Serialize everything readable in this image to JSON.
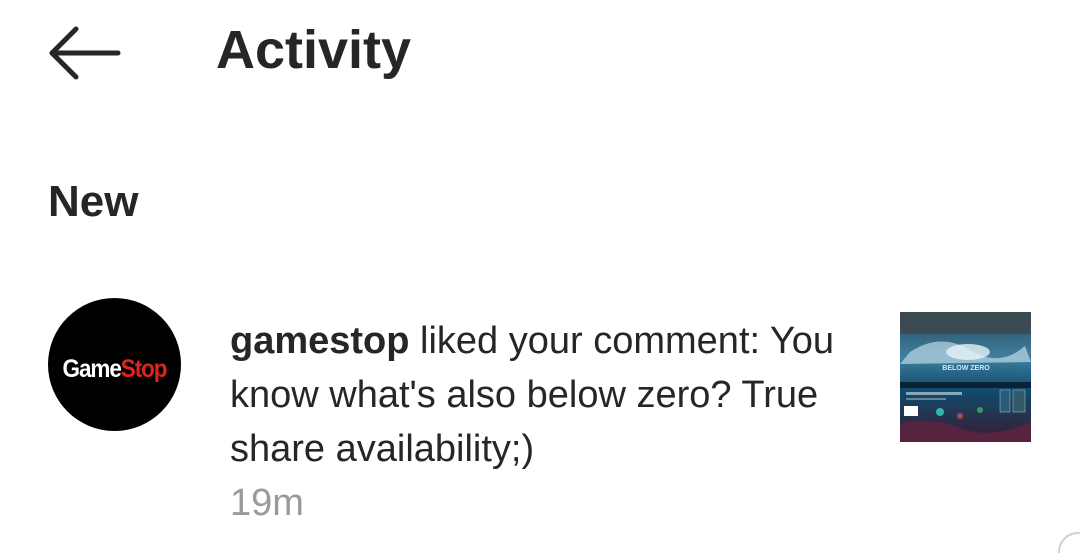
{
  "header": {
    "back_icon": "arrow-left-icon",
    "title": "Activity"
  },
  "sections": [
    {
      "heading": "New",
      "items": [
        {
          "avatar": {
            "logo_text_part1": "Game",
            "logo_text_part2": "Stop",
            "logo_colors": {
              "background": "#000000",
              "part1": "#ffffff",
              "part2": "#e0231c"
            }
          },
          "username": "gamestop",
          "action": " liked your comment: You know what's also below zero? True share availability;)",
          "time": "19m",
          "thumbnail": {
            "description_icon": "post-thumbnail-image",
            "caption": "BELOW ZERO"
          }
        }
      ]
    }
  ],
  "colors": {
    "text_primary": "#262626",
    "text_secondary": "#9a9a9a",
    "background": "#ffffff"
  }
}
